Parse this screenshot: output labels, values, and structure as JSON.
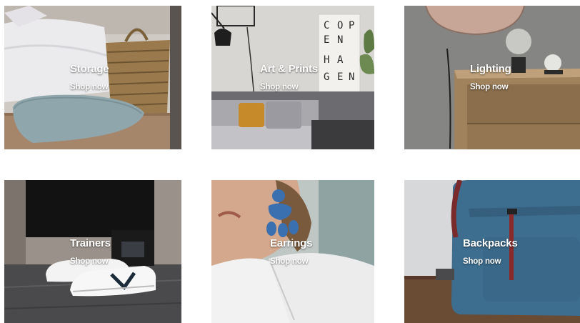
{
  "tiles": [
    {
      "title": "Storage",
      "cta": "Shop now"
    },
    {
      "title": "Art & Prints",
      "cta": "Shop now"
    },
    {
      "title": "Lighting",
      "cta": "Shop now"
    },
    {
      "title": "Trainers",
      "cta": "Shop now"
    },
    {
      "title": "Earrings",
      "cta": "Shop now"
    },
    {
      "title": "Backpacks",
      "cta": "Shop now"
    }
  ],
  "poster_letters": [
    "C",
    "O",
    "P",
    "E",
    "N",
    "H",
    "A",
    "G",
    "E",
    "N"
  ],
  "colors": {
    "text": "#ffffff",
    "background": "#ffffff"
  }
}
